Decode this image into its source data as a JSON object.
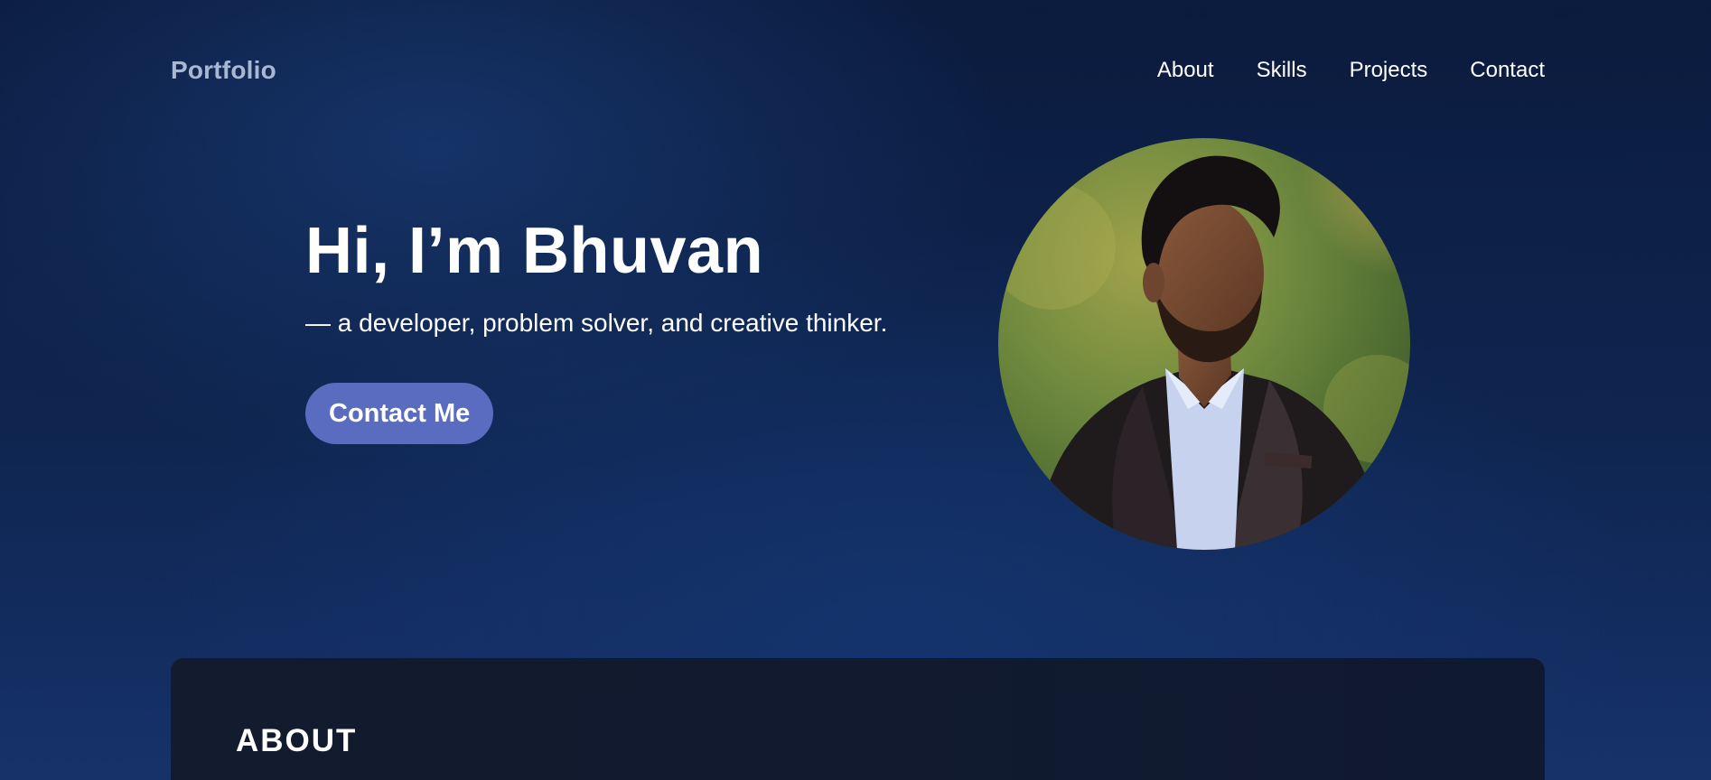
{
  "header": {
    "logo": "Portfolio",
    "nav": [
      "About",
      "Skills",
      "Projects",
      "Contact"
    ]
  },
  "hero": {
    "title": "Hi, I’m Bhuvan",
    "subtitle": "— a developer, problem solver, and creative thinker.",
    "cta_label": "Contact Me"
  },
  "about": {
    "title": "ABOUT"
  },
  "colors": {
    "accent": "#5a6cbf",
    "logo": "#a9b7d3",
    "background": "#0f2550",
    "card": "#131b2e"
  }
}
